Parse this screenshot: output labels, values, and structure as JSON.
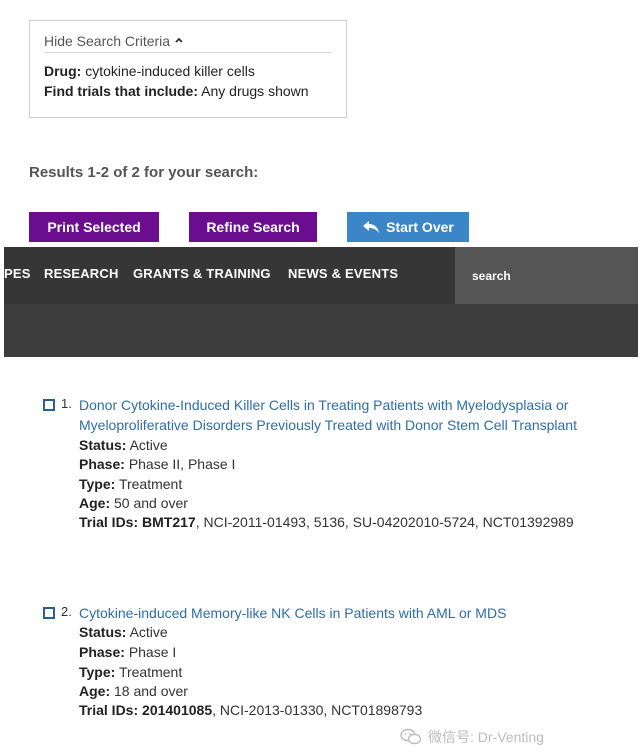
{
  "criteria": {
    "toggle_label": "Hide Search Criteria",
    "drug_label": "Drug:",
    "drug_value": "cytokine-induced killer cells",
    "find_label": "Find trials that include:",
    "find_value": "Any drugs shown"
  },
  "results": {
    "count_text": "Results 1-2 of 2 for your search:"
  },
  "buttons": {
    "print_label": "Print Selected",
    "refine_label": "Refine Search",
    "startover_label": "Start Over"
  },
  "nav": {
    "items": [
      "PES",
      "RESEARCH",
      "GRANTS & TRAINING",
      "NEWS & EVENTS"
    ],
    "search_placeholder": "search"
  },
  "trials": [
    {
      "number": "1.",
      "title": "Donor Cytokine-Induced Killer Cells in Treating Patients with Myelodysplasia or Myeloproliferative Disorders Previously Treated with Donor Stem Cell Transplant",
      "status_label": "Status:",
      "status": "Active",
      "phase_label": "Phase:",
      "phase": "Phase II, Phase I",
      "type_label": "Type:",
      "type": "Treatment",
      "age_label": "Age:",
      "age": "50 and over",
      "ids_label": "Trial IDs:",
      "primary_id": "BMT217",
      "other_ids": ", NCI-2011-01493, 5136, SU-04202010-5724, NCT01392989"
    },
    {
      "number": "2.",
      "title": "Cytokine-induced Memory-like NK Cells in Patients with AML or MDS",
      "status_label": "Status:",
      "status": "Active",
      "phase_label": "Phase:",
      "phase": "Phase I",
      "type_label": "Type:",
      "type": "Treatment",
      "age_label": "Age:",
      "age": "18 and over",
      "ids_label": "Trial IDs:",
      "primary_id": "201401085",
      "other_ids": ", NCI-2013-01330, NCT01898793"
    }
  ],
  "watermark": {
    "text": "微信号: Dr-Venting",
    "icon": "wechat-icon"
  },
  "colors": {
    "purple_button": "#6a0d8f",
    "blue_button": "#3b86c6",
    "link": "#2f6da8",
    "nav_bg": "#363636"
  }
}
